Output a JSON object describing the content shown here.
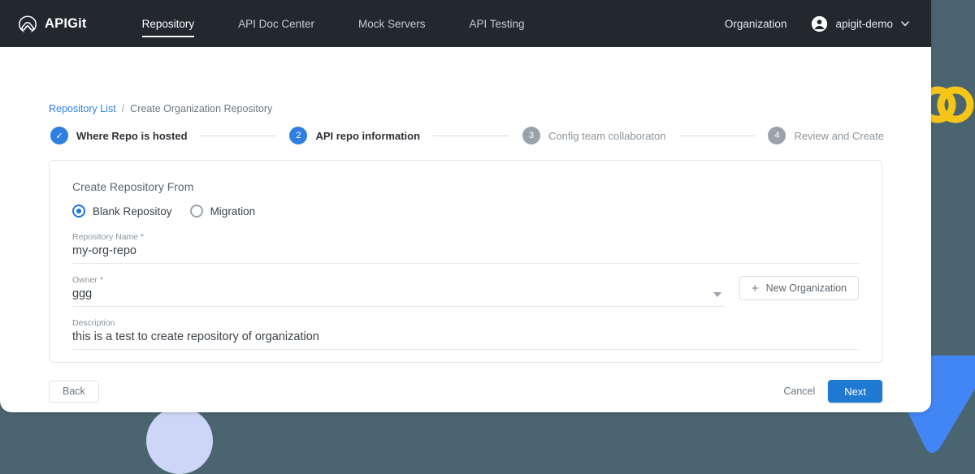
{
  "topbar": {
    "brand": "APIGit",
    "logo_icon": "apigit-chevron-logo-icon",
    "nav": [
      {
        "label": "Repository",
        "active": true
      },
      {
        "label": "API Doc Center",
        "active": false
      },
      {
        "label": "Mock Servers",
        "active": false
      },
      {
        "label": "API Testing",
        "active": false
      }
    ],
    "organization_label": "Organization",
    "user_name": "apigit-demo",
    "user_icon": "account-circle-icon",
    "user_caret_icon": "chevron-down-icon"
  },
  "breadcrumb": {
    "link": "Repository List",
    "separator": "/",
    "current": "Create Organization Repository"
  },
  "stepper": [
    {
      "marker": "✓",
      "label": "Where Repo is hosted",
      "state": "done"
    },
    {
      "marker": "2",
      "label": "API repo information",
      "state": "active"
    },
    {
      "marker": "3",
      "label": "Config team collaboraton",
      "state": "todo"
    },
    {
      "marker": "4",
      "label": "Review and Create",
      "state": "todo"
    }
  ],
  "form": {
    "section_title": "Create Repository From",
    "source_options": [
      {
        "label": "Blank Repositoy",
        "selected": true
      },
      {
        "label": "Migration",
        "selected": false
      }
    ],
    "repository_name": {
      "label": "Repository Name *",
      "value": "my-org-repo",
      "placeholder": "Repository Name"
    },
    "owner": {
      "label": "Owner *",
      "value": "ggg",
      "placeholder": "Owner"
    },
    "description": {
      "label": "Description",
      "value": "this is a test to create repository of organization",
      "placeholder": "Description"
    },
    "new_organization_button": "New Organization",
    "new_organization_icon": "plus-icon"
  },
  "footer": {
    "back": "Back",
    "cancel": "Cancel",
    "next": "Next"
  },
  "colors": {
    "page_background": "#4b6570",
    "topbar": "#23282e",
    "accent_blue": "#1f78d1",
    "link_blue": "#2f7fe0",
    "radio_blue": "#1a73e8",
    "step_todo_gray": "#9aa3ac",
    "deco_yellow": "#f5c518",
    "deco_blue": "#4285f4",
    "deco_lavender": "#cdd6f6"
  }
}
